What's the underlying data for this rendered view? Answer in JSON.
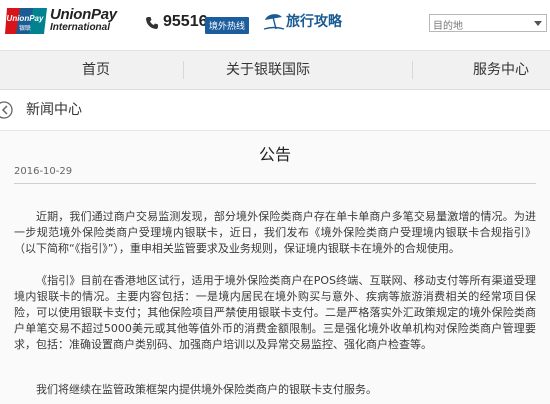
{
  "header": {
    "logo_line1": "UnionPay",
    "logo_line2": "International",
    "badge_text": "UnionPay",
    "badge_sub": "银联",
    "phone_number": "95516",
    "hotline_label": "境外热线",
    "travel_label": "旅行攻略",
    "destination_placeholder": "目的地"
  },
  "nav": {
    "items": [
      "首页",
      "关于银联国际",
      "服务中心"
    ]
  },
  "section": {
    "title": "新闻中心"
  },
  "article": {
    "title": "公告",
    "date": "2016-10-29",
    "paragraphs": [
      "近期，我们通过商户交易监测发现，部分境外保险类商户存在单卡单商户多笔交易量激增的情况。为进一步规范境外保险类商户受理境内银联卡，近日，我们发布《境外保险类商户受理境内银联卡合规指引》（以下简称“《指引》”），重申相关监管要求及业务规则，保证境内银联卡在境外的合规使用。",
      "《指引》目前在香港地区试行，适用于境外保险类商户在POS终端、互联网、移动支付等所有渠道受理境内银联卡的情况。主要内容包括：一是境内居民在境外购买与意外、疾病等旅游消费相关的经常项目保险，可以使用银联卡支付；其他保险项目严禁使用银联卡支付。二是严格落实外汇政策规定的境外保险类商户单笔交易不超过5000美元或其他等值外币的消费金额限制。三是强化境外收单机构对保险类商户管理要求，包括：准确设置商户类别码、加强商户培训以及异常交易监控、强化商户检查等。",
      "我们将继续在监管政策框架内提供境外保险类商户的银联卡支付服务。"
    ]
  },
  "colors": {
    "brand_red": "#d7141a",
    "brand_blue": "#1b5b94",
    "brand_teal": "#00838f",
    "hotline_bg": "#1c5d9e"
  }
}
